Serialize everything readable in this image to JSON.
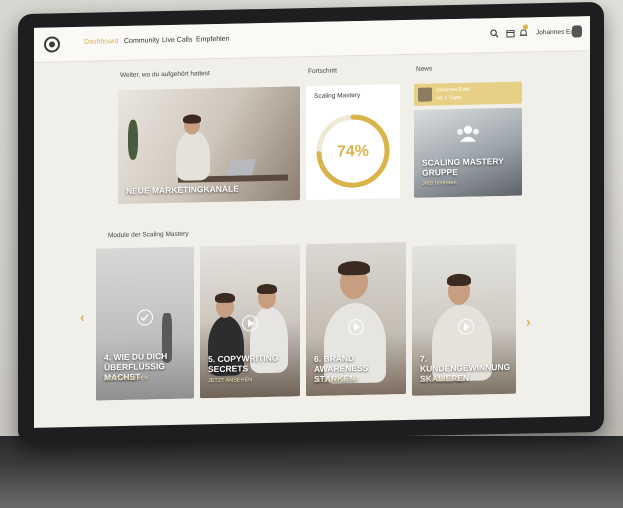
{
  "nav": {
    "items": [
      "Dashboard",
      "Community",
      "Live Calls",
      "Empfehlen"
    ],
    "active_index": 0,
    "username": "Johannes Eder"
  },
  "sections": {
    "continue_heading": "Weiter, wo du aufgehört hattest",
    "progress_heading": "Fortschritt",
    "news_heading": "News",
    "modules_heading": "Module der Scaling Mastery"
  },
  "continue_card": {
    "title": "NEUE MARKETINGKANÄLE"
  },
  "progress_card": {
    "label": "Scaling Mastery",
    "value_text": "74%",
    "value": 0.74
  },
  "news": {
    "line1": "Johannes Eder",
    "line2": "vor 2 Tagen",
    "card_title_line1": "SCALING MASTERY",
    "card_title_line2": "GRUPPE",
    "card_sub": "Jetzt beitreten"
  },
  "modules": [
    {
      "title": "4. WIE DU DICH ÜBERFLÜSSIG MACHST",
      "sub": "JETZT ANSEHEN",
      "completed": true
    },
    {
      "title": "5. COPYWRITING SECRETS",
      "sub": "JETZT ANSEHEN",
      "completed": false
    },
    {
      "title": "6. BRAND AWARENESS STÄRKEN",
      "sub": "JETZT ANSEHEN",
      "completed": false
    },
    {
      "title": "7. KUNDENGEWINNUNG SKALIEREN",
      "sub": "JETZT ANSEHEN",
      "completed": false
    }
  ],
  "colors": {
    "accent": "#d8b44a",
    "background": "#f1efea"
  },
  "icons": [
    "search-icon",
    "calendar-icon",
    "bell-icon",
    "avatar",
    "chevron-left-icon",
    "chevron-right-icon",
    "play-icon",
    "check-icon",
    "logo-icon"
  ]
}
